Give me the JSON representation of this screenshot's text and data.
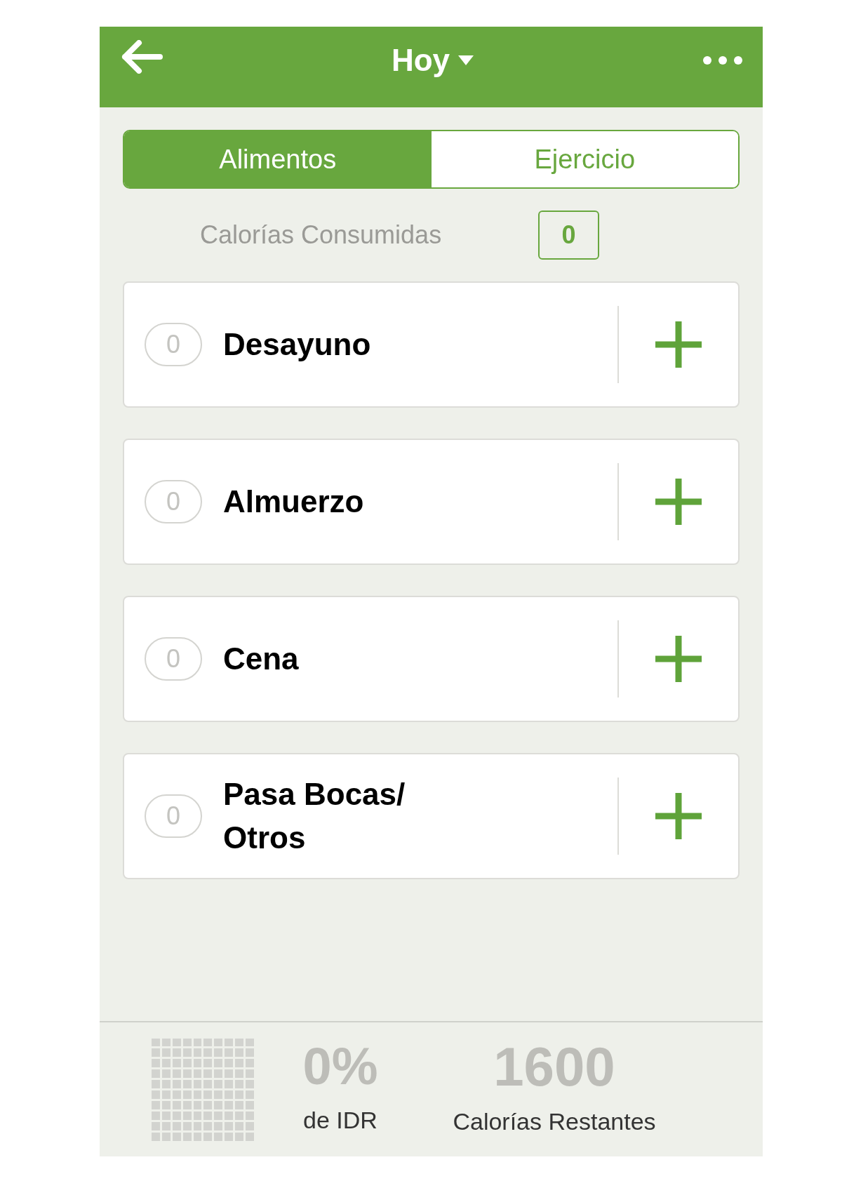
{
  "header": {
    "title": "Hoy"
  },
  "tabs": [
    {
      "label": "Alimentos",
      "selected": true
    },
    {
      "label": "Ejercicio",
      "selected": false
    }
  ],
  "consumed": {
    "label": "Calorías Consumidas",
    "value": "0"
  },
  "meals": [
    {
      "count": "0",
      "name": "Desayuno"
    },
    {
      "count": "0",
      "name": "Almuerzo"
    },
    {
      "count": "0",
      "name": "Cena"
    },
    {
      "count": "0",
      "name": "Pasa Bocas/ Otros"
    }
  ],
  "footer": {
    "idr": {
      "value": "0%",
      "label": "de IDR"
    },
    "remaining": {
      "value": "1600",
      "label": "Calorías Restantes"
    }
  }
}
